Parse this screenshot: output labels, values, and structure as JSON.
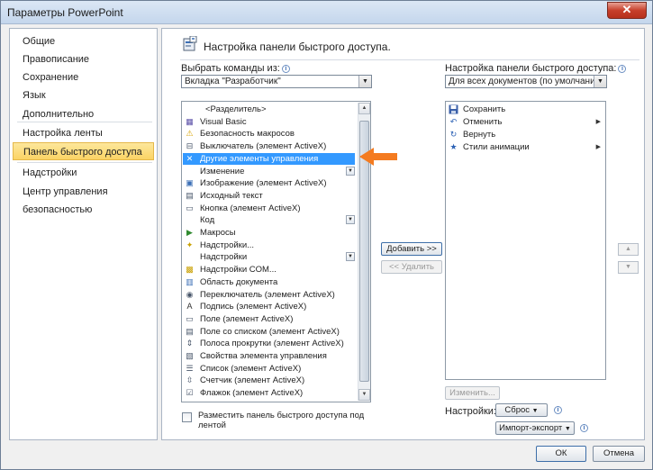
{
  "window": {
    "title": "Параметры PowerPoint",
    "close_glyph": "✕"
  },
  "nav": {
    "items": [
      {
        "label": "Общие"
      },
      {
        "label": "Правописание"
      },
      {
        "label": "Сохранение"
      },
      {
        "label": "Язык"
      },
      {
        "label": "Дополнительно"
      },
      {
        "label": "Настройка ленты"
      },
      {
        "label": "Панель быстрого доступа",
        "active": true
      },
      {
        "label": "Надстройки"
      },
      {
        "label": "Центр управления безопасностью"
      }
    ]
  },
  "header": {
    "title": "Настройка панели быстрого доступа.",
    "icon": "quick-access-settings-icon"
  },
  "left": {
    "choose_label": "Выбрать команды из:",
    "choose_value": "Вкладка \"Разработчик\"",
    "commands": [
      {
        "label": "<Разделитель>",
        "icon": ""
      },
      {
        "label": "Visual Basic",
        "icon": "visual-basic-icon"
      },
      {
        "label": "Безопасность макросов",
        "icon": "warning-icon"
      },
      {
        "label": "Выключатель (элемент ActiveX)",
        "icon": "toggle-icon"
      },
      {
        "label": "Другие элементы управления",
        "icon": "tools-icon",
        "selected": true
      },
      {
        "label": "Изменение",
        "icon": "",
        "submenu": true
      },
      {
        "label": "Изображение (элемент ActiveX)",
        "icon": "image-icon"
      },
      {
        "label": "Исходный текст",
        "icon": "source-icon"
      },
      {
        "label": "Кнопка (элемент ActiveX)",
        "icon": "button-icon"
      },
      {
        "label": "Код",
        "icon": "",
        "submenu": true
      },
      {
        "label": "Макросы",
        "icon": "play-icon"
      },
      {
        "label": "Надстройки...",
        "icon": "addins-icon"
      },
      {
        "label": "Надстройки",
        "icon": "",
        "submenu": true
      },
      {
        "label": "Надстройки COM...",
        "icon": "com-addins-icon"
      },
      {
        "label": "Область документа",
        "icon": "document-area-icon"
      },
      {
        "label": "Переключатель (элемент ActiveX)",
        "icon": "radio-icon"
      },
      {
        "label": "Подпись (элемент ActiveX)",
        "icon": "label-icon"
      },
      {
        "label": "Поле (элемент ActiveX)",
        "icon": "textbox-icon"
      },
      {
        "label": "Поле со списком (элемент ActiveX)",
        "icon": "combobox-icon"
      },
      {
        "label": "Полоса прокрутки (элемент ActiveX)",
        "icon": "scrollbar-icon"
      },
      {
        "label": "Свойства элемента управления",
        "icon": "properties-icon"
      },
      {
        "label": "Список (элемент ActiveX)",
        "icon": "listbox-icon"
      },
      {
        "label": "Счетчик (элемент ActiveX)",
        "icon": "spinner-icon"
      },
      {
        "label": "Флажок (элемент ActiveX)",
        "icon": "checkbox-icon"
      }
    ],
    "checkbox_label": "Разместить панель быстрого доступа под лентой"
  },
  "middle": {
    "add_label": "Добавить >>",
    "remove_label": "<< Удалить"
  },
  "right": {
    "customize_label": "Настройка панели быстрого доступа:",
    "customize_value": "Для всех документов (по умолчанию)",
    "items": [
      {
        "label": "Сохранить",
        "icon": "save-icon"
      },
      {
        "label": "Отменить",
        "icon": "undo-icon",
        "submenu": true
      },
      {
        "label": "Вернуть",
        "icon": "redo-icon"
      },
      {
        "label": "Стили анимации",
        "icon": "animation-star-icon",
        "submenu": true
      }
    ],
    "modify_label": "Изменить...",
    "settings_label": "Настройки:",
    "reset_label": "Сброс",
    "import_export_label": "Импорт-экспорт"
  },
  "footer": {
    "ok_label": "ОК",
    "cancel_label": "Отмена"
  },
  "colors": {
    "selection": "#3399ff",
    "nav_active": "#fbd364",
    "callout_arrow": "#f47b20"
  }
}
